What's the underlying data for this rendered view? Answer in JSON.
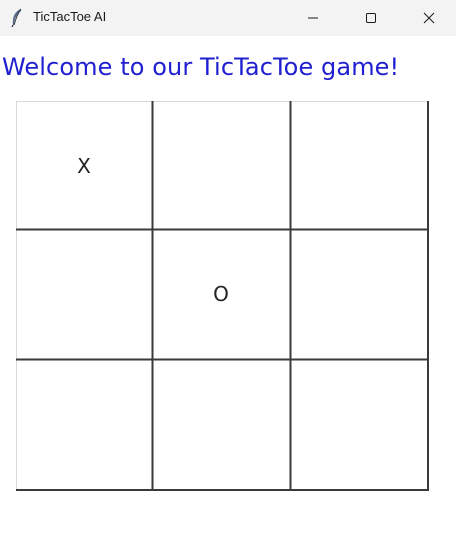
{
  "window": {
    "title": "TicTacToe AI",
    "icon": "feather-icon",
    "controls": [
      "minimize-icon",
      "maximize-icon",
      "close-icon"
    ]
  },
  "heading": {
    "text": "Welcome to our TicTacToe game!",
    "color": "#2020d0"
  },
  "board": {
    "rows": [
      [
        "X",
        "",
        ""
      ],
      [
        "",
        "O",
        ""
      ],
      [
        "",
        "",
        ""
      ]
    ]
  }
}
